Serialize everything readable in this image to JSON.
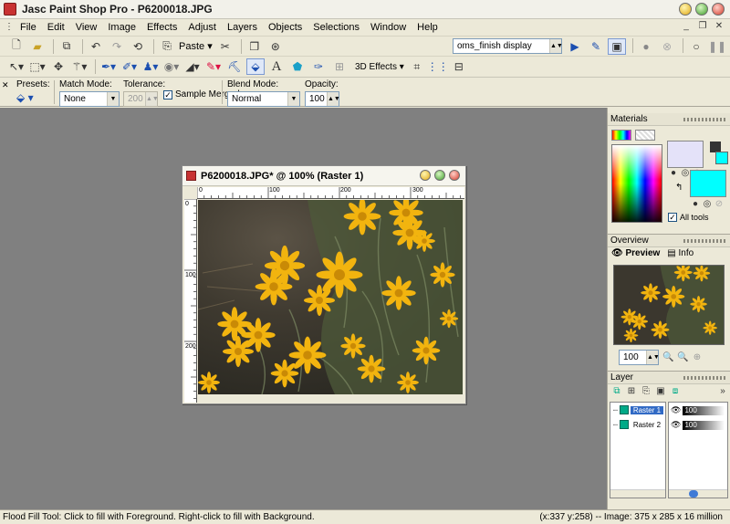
{
  "app": {
    "title": "Jasc Paint Shop Pro - P6200018.JPG"
  },
  "menu": [
    "File",
    "Edit",
    "View",
    "Image",
    "Effects",
    "Adjust",
    "Layers",
    "Objects",
    "Selections",
    "Window",
    "Help"
  ],
  "toolbar1": {
    "paste_label": "Paste",
    "script_select": "oms_finish display"
  },
  "toolbar2": {
    "effects_label": "3D Effects"
  },
  "tool_options": {
    "presets_label": "Presets:",
    "match_mode_label": "Match Mode:",
    "match_mode_value": "None",
    "tolerance_label": "Tolerance:",
    "tolerance_value": "200",
    "sample_merged_label": "Sample Merged",
    "blend_mode_label": "Blend Mode:",
    "blend_mode_value": "Normal",
    "opacity_label": "Opacity:",
    "opacity_value": "100"
  },
  "image_window": {
    "title": "P6200018.JPG* @ 100% (Raster 1)",
    "hruler_labels": [
      "0",
      "100",
      "200",
      "300"
    ],
    "vruler_labels": [
      "0",
      "100",
      "200"
    ]
  },
  "materials": {
    "title": "Materials",
    "all_tools_label": "All tools",
    "foreground_color": "#e4e2f9",
    "background_color": "#00ffff"
  },
  "overview": {
    "title": "Overview",
    "tab_preview": "Preview",
    "tab_info": "Info",
    "zoom_value": "100"
  },
  "layers": {
    "title": "Layer",
    "items": [
      {
        "name": "Raster 1",
        "opacity": "100",
        "selected": true
      },
      {
        "name": "Raster 2",
        "opacity": "100",
        "selected": false
      }
    ]
  },
  "status": {
    "left": "Flood Fill Tool: Click to fill with Foreground. Right-click to fill with Background.",
    "right": "(x:337 y:258) -- Image:  375 x 285 x 16 million"
  },
  "colors": {
    "workspace": "#808080",
    "selection": "#316ac5"
  }
}
